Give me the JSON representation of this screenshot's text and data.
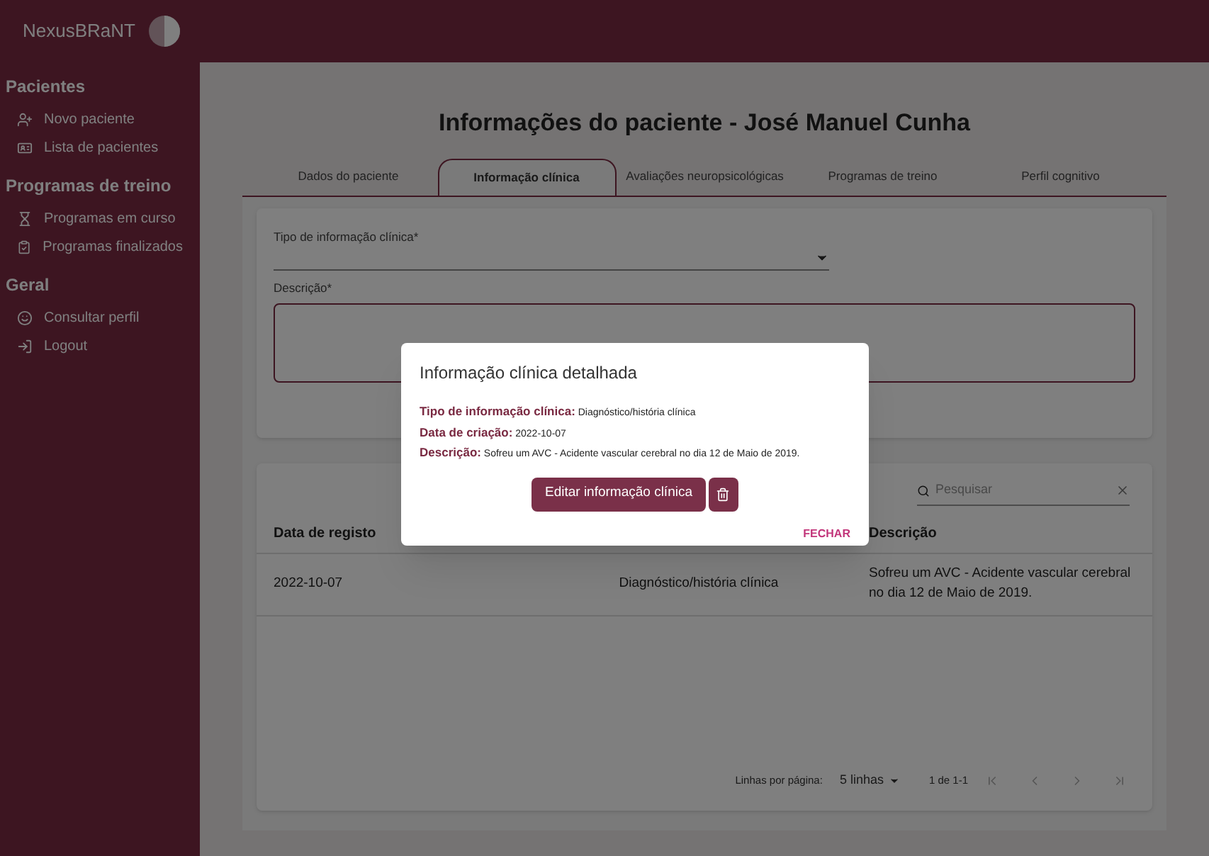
{
  "app": {
    "brand": "NexusBRaNT"
  },
  "sidebar": {
    "sections": [
      {
        "title": "Pacientes",
        "items": [
          {
            "label": "Novo paciente"
          },
          {
            "label": "Lista de pacientes"
          }
        ]
      },
      {
        "title": "Programas de treino",
        "items": [
          {
            "label": "Programas em curso"
          },
          {
            "label": "Programas finalizados"
          }
        ]
      },
      {
        "title": "Geral",
        "items": [
          {
            "label": "Consultar perfil"
          },
          {
            "label": "Logout"
          }
        ]
      }
    ]
  },
  "page_title": "Informações do paciente - José Manuel Cunha",
  "tabs": [
    {
      "label": "Dados do paciente",
      "selected": false
    },
    {
      "label": "Informação clínica",
      "selected": true
    },
    {
      "label": "Avaliações neuropsicológicas",
      "selected": false
    },
    {
      "label": "Programas de treino",
      "selected": false
    },
    {
      "label": "Perfil cognitivo",
      "selected": false
    }
  ],
  "form": {
    "type_label": "Tipo de informação clínica*",
    "description_label": "Descrição*"
  },
  "table": {
    "search": {
      "placeholder": "Pesquisar"
    },
    "columns": [
      "Data de registo",
      "",
      "Descrição"
    ],
    "rows": [
      {
        "date": "2022-10-07",
        "type": "Diagnóstico/história clínica",
        "description": "Sofreu um AVC - Acidente vascular cerebral no dia 12 de Maio de 2019."
      }
    ],
    "pagination": {
      "rows_label": "Linhas por página:",
      "rows_value": "5 linhas",
      "range": "1 de 1-1"
    }
  },
  "dialog": {
    "title": "Informação clínica detalhada",
    "fields": [
      {
        "label": "Tipo de informação clínica:",
        "value": "Diagnóstico/história clínica"
      },
      {
        "label": "Data de criação:",
        "value": "2022-10-07"
      },
      {
        "label": "Descrição:",
        "value": "Sofreu um AVC - Acidente vascular cerebral no dia 12 de Maio de 2019."
      }
    ],
    "edit_button": "Editar informação clínica",
    "close_button": "FECHAR"
  }
}
